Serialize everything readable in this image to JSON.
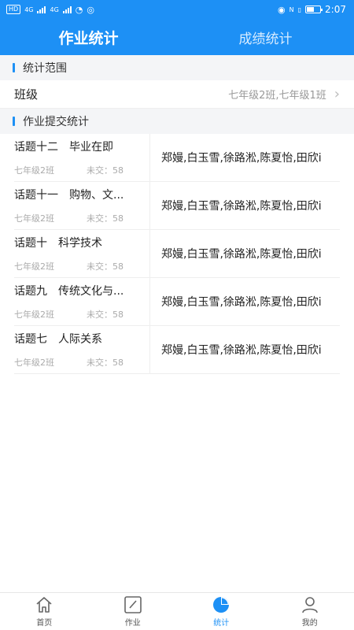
{
  "status_bar": {
    "left_chip": "HD",
    "net1": "4G",
    "net2": "4G",
    "net2_left": "HD",
    "time": "2:07",
    "battery_level": 0.55
  },
  "tabs": {
    "active": "作业统计",
    "inactive": "成绩统计"
  },
  "range_section": {
    "title": "统计范围",
    "row_label": "班级",
    "row_value": "七年级2班,七年级1班"
  },
  "submit_section": {
    "title": "作业提交统计"
  },
  "homeworks": [
    {
      "title": "话题十二　毕业在即",
      "class": "七年级2班",
      "unsubmitted": "未交：58",
      "students": "郑嫚,白玉雪,徐路淞,陈夏怡,田欣i"
    },
    {
      "title": "话题十一　购物、文...",
      "class": "七年级2班",
      "unsubmitted": "未交：58",
      "students": "郑嫚,白玉雪,徐路淞,陈夏怡,田欣i"
    },
    {
      "title": "话题十　科学技术",
      "class": "七年级2班",
      "unsubmitted": "未交：58",
      "students": "郑嫚,白玉雪,徐路淞,陈夏怡,田欣i"
    },
    {
      "title": "话题九　传统文化与...",
      "class": "七年级2班",
      "unsubmitted": "未交：58",
      "students": "郑嫚,白玉雪,徐路淞,陈夏怡,田欣i"
    },
    {
      "title": "话题七　人际关系",
      "class": "七年级2班",
      "unsubmitted": "未交：58",
      "students": "郑嫚,白玉雪,徐路淞,陈夏怡,田欣i"
    }
  ],
  "bottom_nav": [
    {
      "label": "首页",
      "icon": "home-icon"
    },
    {
      "label": "作业",
      "icon": "edit-icon"
    },
    {
      "label": "统计",
      "icon": "pie-chart-icon",
      "active": true
    },
    {
      "label": "我的",
      "icon": "person-icon"
    }
  ],
  "colors": {
    "primary": "#1d90f5",
    "section_bg": "#f4f5f7"
  }
}
